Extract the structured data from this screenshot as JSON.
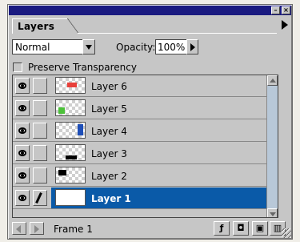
{
  "panel": {
    "tab_label": "Layers",
    "blend_mode": "Normal",
    "opacity_label": "Opacity:",
    "opacity_value": "100%",
    "preserve_label": "Preserve Transparency",
    "preserve_checked": false
  },
  "layers": [
    {
      "name": "Layer 6",
      "visible": true,
      "swatch_color": "#e8403a",
      "selected": false
    },
    {
      "name": "Layer 5",
      "visible": true,
      "swatch_color": "#4cc13a",
      "selected": false
    },
    {
      "name": "Layer 4",
      "visible": true,
      "swatch_color": "#1f4fb8",
      "selected": false
    },
    {
      "name": "Layer 3",
      "visible": true,
      "swatch_color": "#000000",
      "selected": false
    },
    {
      "name": "Layer 2",
      "visible": true,
      "swatch_color": "#000000",
      "selected": false
    },
    {
      "name": "Layer 1",
      "visible": true,
      "swatch_color": "#ffffff",
      "selected": true
    }
  ],
  "footer": {
    "frame_label": "Frame 1"
  },
  "colors": {
    "title_bar": "#1a1a80",
    "selection": "#0a5aa8",
    "panel_bg": "#c6c6c6"
  }
}
